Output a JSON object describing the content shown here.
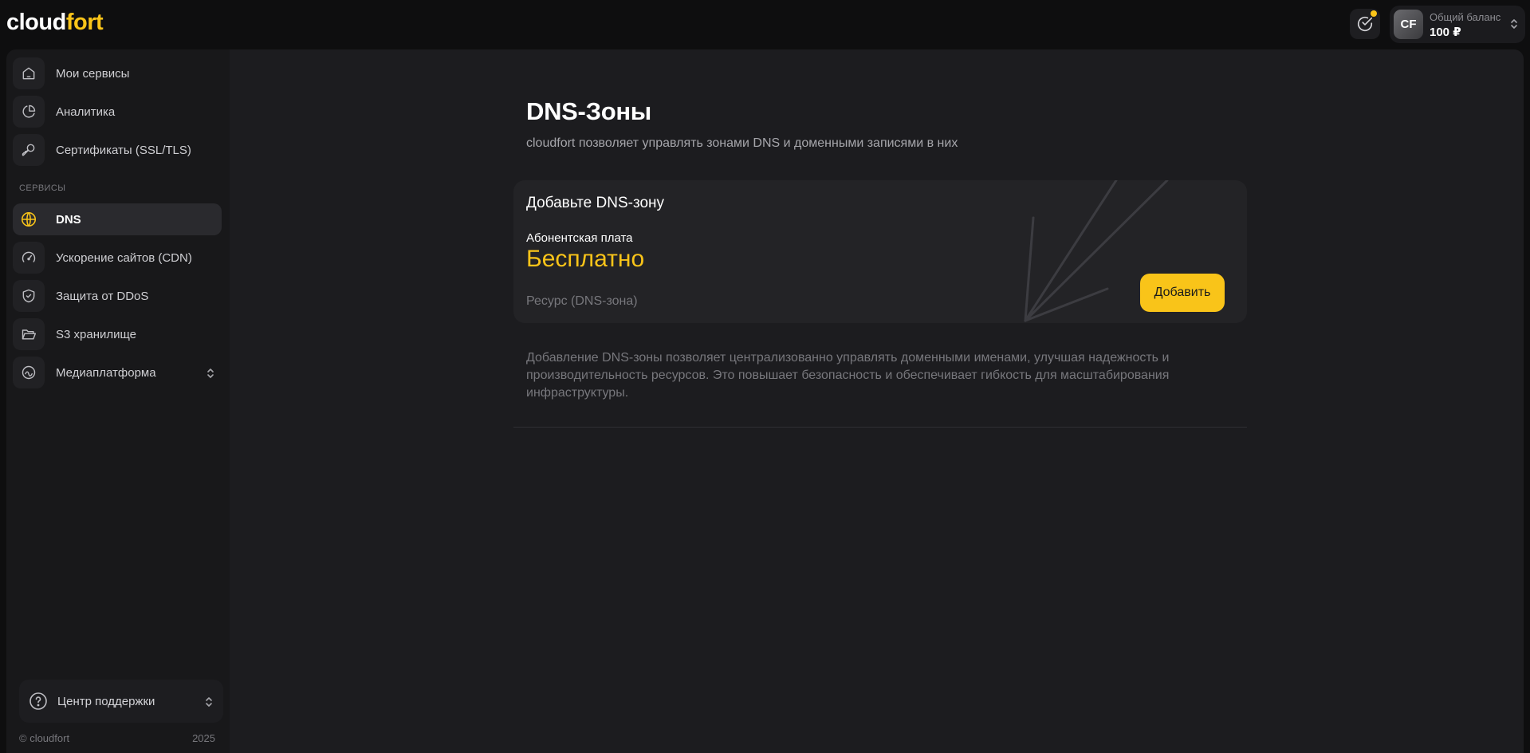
{
  "brand": {
    "logo_part1": "cloud",
    "logo_part2": "fort"
  },
  "header": {
    "balance_label": "Общий баланс",
    "balance_value": "100 ₽",
    "avatar_initials": "CF"
  },
  "sidebar": {
    "items": [
      {
        "label": "Мои сервисы",
        "icon": "home-icon"
      },
      {
        "label": "Аналитика",
        "icon": "pie-chart-icon"
      },
      {
        "label": "Сертификаты (SSL/TLS)",
        "icon": "key-icon"
      }
    ],
    "section_label": "СЕРВИСЫ",
    "services": [
      {
        "label": "DNS",
        "icon": "globe-icon",
        "active": true
      },
      {
        "label": "Ускорение сайтов (CDN)",
        "icon": "speedometer-icon"
      },
      {
        "label": "Защита от DDoS",
        "icon": "shield-icon"
      },
      {
        "label": "S3 хранилище",
        "icon": "folder-icon"
      },
      {
        "label": "Медиаплатформа",
        "icon": "media-icon"
      }
    ],
    "support_label": "Центр поддержки",
    "copyright": "© cloudfort",
    "year": "2025"
  },
  "main": {
    "title": "DNS-Зоны",
    "subtitle": "cloudfort позволяет управлять зонами DNS и доменными записями в них",
    "card": {
      "title": "Добавьте DNS-зону",
      "fee_label": "Абонентская плата",
      "fee_value": "Бесплатно",
      "resource_label": "Ресурс (DNS-зона)",
      "add_button": "Добавить"
    },
    "description": "Добавление DNS-зоны позволяет централизованно управлять доменными именами, улучшая надежность и производительность ресурсов. Это повышает безопасность и обеспечивает гибкость для масштабирования инфраструктуры."
  },
  "colors": {
    "accent": "#f9c419",
    "background": "#0e0e0f",
    "panel": "#1c1c1f",
    "card": "#232326"
  }
}
